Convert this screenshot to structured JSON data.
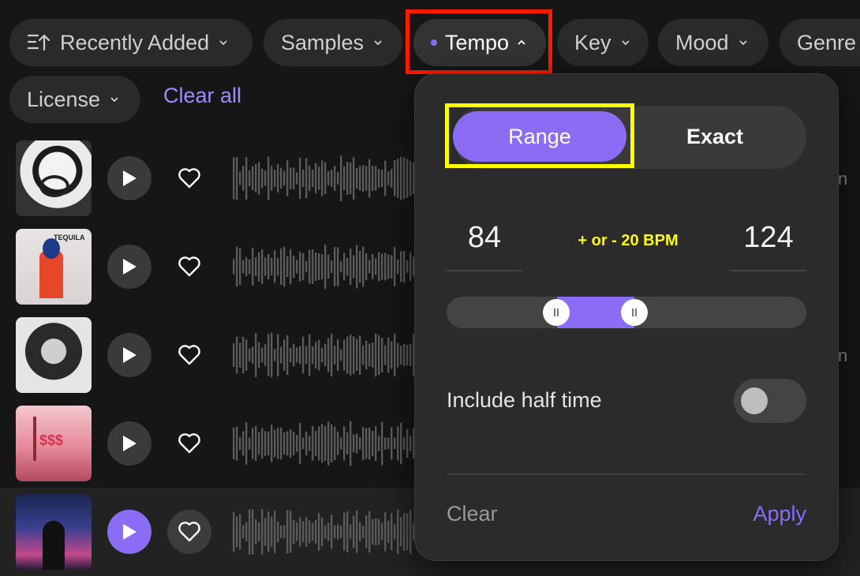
{
  "filters": {
    "sort_label": "Recently Added",
    "samples_label": "Samples",
    "tempo_label": "Tempo",
    "key_label": "Key",
    "mood_label": "Mood",
    "genre_label": "Genre",
    "license_label": "License",
    "clear_all_label": "Clear all"
  },
  "tempo_panel": {
    "mode_range_label": "Range",
    "mode_exact_label": "Exact",
    "selected_mode": "Range",
    "bpm_min": "84",
    "bpm_max": "124",
    "tolerance_note": "+ or - 20 BPM",
    "half_time_label": "Include half time",
    "half_time_enabled": false,
    "clear_label": "Clear",
    "apply_label": "Apply"
  },
  "tracks": [
    {
      "cover_text": "",
      "trailing_text": "n"
    },
    {
      "cover_text": "TEQUILA",
      "trailing_text": ""
    },
    {
      "cover_text": "",
      "trailing_text": "n"
    },
    {
      "cover_text": "$$$",
      "trailing_text": ""
    },
    {
      "cover_text": "",
      "trailing_text": ""
    }
  ],
  "colors": {
    "accent": "#8a6cf5",
    "background": "#161616",
    "panel": "#2b2b2b"
  }
}
